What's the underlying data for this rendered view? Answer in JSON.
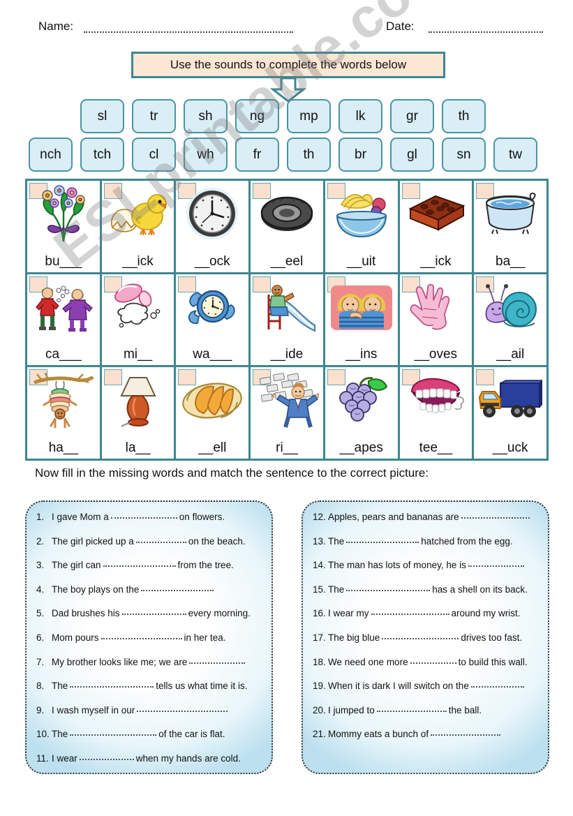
{
  "header": {
    "name_label": "Name:",
    "date_label": "Date:",
    "banner_text": "Use the sounds  to complete the words below"
  },
  "watermark": "ESLprintable.com",
  "sounds": {
    "row1": [
      "sl",
      "tr",
      "sh",
      "ng",
      "mp",
      "lk",
      "gr",
      "th"
    ],
    "row2": [
      "nch",
      "tch",
      "cl",
      "wh",
      "fr",
      "th",
      "br",
      "gl",
      "sn",
      "tw"
    ]
  },
  "picture_grid": {
    "cells": [
      {
        "word": "bu___",
        "icon": "bunch-of-flowers-icon"
      },
      {
        "word": "__ick",
        "icon": "chick-icon"
      },
      {
        "word": "__ock",
        "icon": "clock-icon"
      },
      {
        "word": "__eel",
        "icon": "wheel-icon"
      },
      {
        "word": "__uit",
        "icon": "fruit-bowl-icon"
      },
      {
        "word": "__ick",
        "icon": "brick-icon"
      },
      {
        "word": "ba__",
        "icon": "bath-icon"
      },
      {
        "word": "ca___",
        "icon": "catch-ball-icon"
      },
      {
        "word": "mi__",
        "icon": "spilled-milk-icon"
      },
      {
        "word": "wa___",
        "icon": "watch-icon"
      },
      {
        "word": "__ide",
        "icon": "slide-icon"
      },
      {
        "word": "__ins",
        "icon": "twins-icon"
      },
      {
        "word": "__oves",
        "icon": "gloves-icon"
      },
      {
        "word": "__ail",
        "icon": "snail-icon"
      },
      {
        "word": "ha__",
        "icon": "hanging-man-icon"
      },
      {
        "word": "la__",
        "icon": "lamp-icon"
      },
      {
        "word": "__ell",
        "icon": "shell-icon"
      },
      {
        "word": "ri__",
        "icon": "rich-money-icon"
      },
      {
        "word": "__apes",
        "icon": "grapes-icon"
      },
      {
        "word": "tee__",
        "icon": "teeth-icon"
      },
      {
        "word": "__uck",
        "icon": "truck-icon"
      }
    ]
  },
  "instruction2": "Now fill in the missing words and match the sentence to the correct picture:",
  "sentences_left": [
    {
      "num": "1.",
      "before": "I gave Mom a",
      "blank": 95,
      "after": "on flowers."
    },
    {
      "num": "2.",
      "before": "The girl picked up a",
      "blank": 72,
      "after": "on the beach."
    },
    {
      "num": "3.",
      "before": "The girl can",
      "blank": 104,
      "after": "from the tree."
    },
    {
      "num": "4.",
      "before": "The boy plays on the",
      "blank": 104,
      "after": ""
    },
    {
      "num": "5.",
      "before": "Dad brushes his",
      "blank": 92,
      "after": "every morning."
    },
    {
      "num": "6.",
      "before": "Mom pours",
      "blank": 116,
      "after": "in her tea."
    },
    {
      "num": "7.",
      "before": "My brother looks like me; we are",
      "blank": 80,
      "after": ""
    },
    {
      "num": "8.",
      "before": "The",
      "blank": 120,
      "after": "tells us what time it is."
    },
    {
      "num": "9.",
      "before": "I wash myself in our",
      "blank": 130,
      "after": ""
    },
    {
      "num": "10.",
      "before": "The",
      "blank": 124,
      "after": "of the car is flat."
    },
    {
      "num": "11.",
      "before": "I wear",
      "blank": 78,
      "after": "when my hands are cold."
    }
  ],
  "sentences_right": [
    {
      "num": "12.",
      "before": "Apples, pears and bananas are",
      "blank": 98,
      "after": ""
    },
    {
      "num": "13.",
      "before": "The",
      "blank": 104,
      "after": "hatched from the egg."
    },
    {
      "num": "14.",
      "before": "The man has lots of money, he is",
      "blank": 80,
      "after": ""
    },
    {
      "num": "15.",
      "before": "The",
      "blank": 120,
      "after": "has a shell on its back."
    },
    {
      "num": "16.",
      "before": "I wear my",
      "blank": 112,
      "after": "around my wrist."
    },
    {
      "num": "17.",
      "before": "The big blue",
      "blank": 110,
      "after": "drives too fast."
    },
    {
      "num": "18.",
      "before": "We need one more",
      "blank": 66,
      "after": "to build this wall."
    },
    {
      "num": "19.",
      "before": "When it is dark I will switch on the",
      "blank": 76,
      "after": ""
    },
    {
      "num": "20.",
      "before": "I jumped to",
      "blank": 100,
      "after": "the ball."
    },
    {
      "num": "21.",
      "before": "Mommy eats a bunch of",
      "blank": 100,
      "after": ""
    }
  ],
  "colors": {
    "teal_border": "#3d8692",
    "tile_fill": "#d9eef5",
    "tile_border": "#4b93a2",
    "banner_fill": "#fce6d4",
    "tab_fill": "#fbe0cd"
  }
}
